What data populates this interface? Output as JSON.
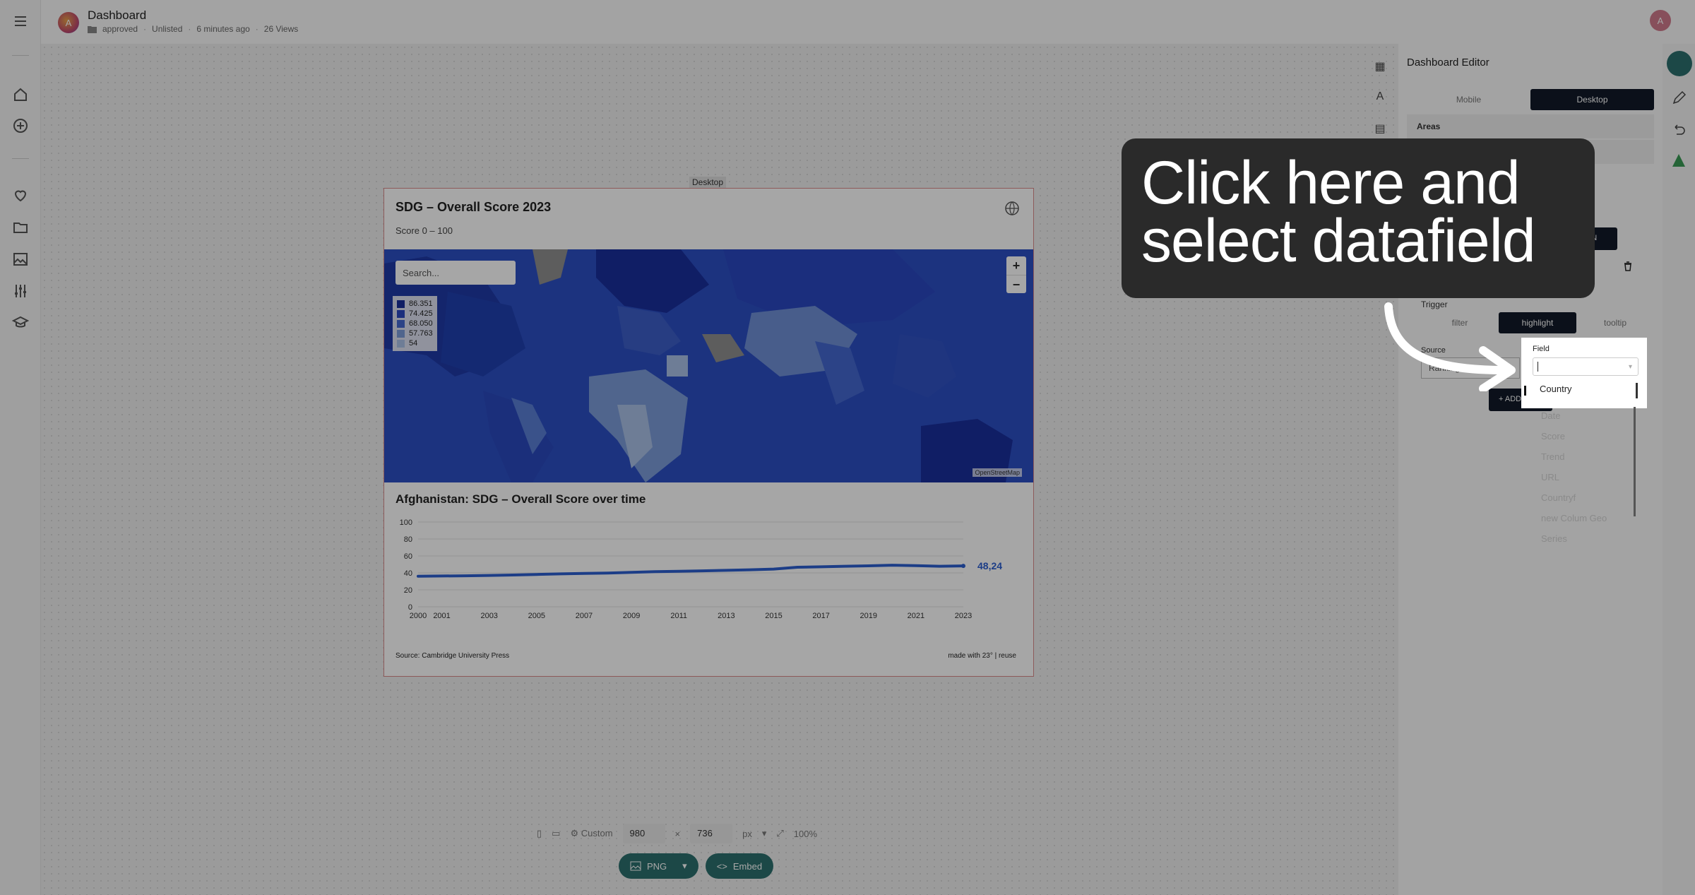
{
  "header": {
    "title": "Dashboard",
    "folder": "approved",
    "visibility": "Unlisted",
    "updated": "6 minutes ago",
    "views": "26 Views",
    "user_initial": "A",
    "logo_initial": "A"
  },
  "canvas": {
    "device_tag": "Desktop"
  },
  "card": {
    "title": "SDG – Overall Score 2023",
    "subtitle": "Score 0 – 100",
    "search_placeholder": "Search...",
    "legend": [
      {
        "label": "86.351",
        "color": "#1a2e9c"
      },
      {
        "label": "74.425",
        "color": "#2a47c0"
      },
      {
        "label": "68.050",
        "color": "#4468cf"
      },
      {
        "label": "57.763",
        "color": "#7b9bd9"
      },
      {
        "label": "54",
        "color": "#a9c1e6"
      }
    ],
    "zoom_in": "+",
    "zoom_out": "−",
    "map_attribution": "OpenStreetMap",
    "line_title": "Afghanistan: SDG – Overall Score over time",
    "source": "Source: Cambridge University Press",
    "made_with": "made with 23° | reuse"
  },
  "chart_data": {
    "type": "line",
    "title": "Afghanistan: SDG – Overall Score over time",
    "x": [
      2000,
      2001,
      2002,
      2003,
      2004,
      2005,
      2006,
      2007,
      2008,
      2009,
      2010,
      2011,
      2012,
      2013,
      2014,
      2015,
      2016,
      2017,
      2018,
      2019,
      2020,
      2021,
      2022,
      2023
    ],
    "x_tick_labels": [
      "2000",
      "2001",
      "2003",
      "2005",
      "2007",
      "2009",
      "2011",
      "2013",
      "2015",
      "2017",
      "2019",
      "2021",
      "2023"
    ],
    "y_ticks": [
      "0",
      "20",
      "40",
      "60",
      "80",
      "100"
    ],
    "ylim": [
      0,
      100
    ],
    "series": [
      {
        "values": [
          36.1,
          36.3,
          36.6,
          37.0,
          37.5,
          38.2,
          38.8,
          39.3,
          39.8,
          40.6,
          41.4,
          41.8,
          42.4,
          43.0,
          43.7,
          44.5,
          46.7,
          47.2,
          47.8,
          48.3,
          49.1,
          48.6,
          47.8,
          48.24
        ],
        "color": "#2c5fd0"
      }
    ],
    "end_label": "48,24"
  },
  "bottom_bar": {
    "preset": "Custom",
    "width": "980",
    "x_sep": "×",
    "height": "736",
    "unit": "px",
    "zoom": "100%",
    "png_label": "PNG",
    "embed_label": "Embed"
  },
  "editor": {
    "title": "Dashboard Editor",
    "mobile": "Mobile",
    "desktop": "Desktop",
    "areas": "Areas",
    "presets": "Presets",
    "action_button": "ADD ACTION",
    "trigger_label": "Trigger",
    "trigger_filter": "filter",
    "trigger_highlight": "highlight",
    "trigger_tooltip": "tooltip",
    "source_label": "Source",
    "source_value": "Ranking",
    "add_button": "+ ADD"
  },
  "field_dropdown": {
    "label": "Field",
    "selected": "Country",
    "options": [
      "Date",
      "Score",
      "Trend",
      "URL",
      "Countryf",
      "new Colum Geo",
      "Series"
    ]
  },
  "callout": {
    "text_line1": "Click here and",
    "text_line2": "select datafield"
  }
}
